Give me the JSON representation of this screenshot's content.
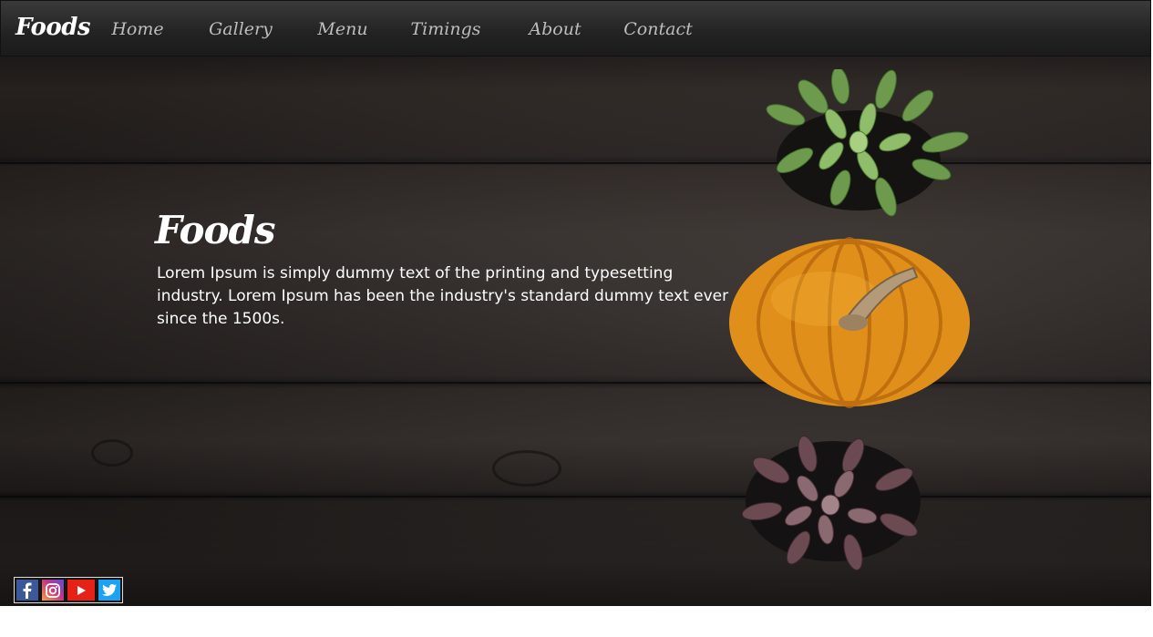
{
  "brand": "Foods",
  "nav": {
    "items": [
      {
        "label": "Home"
      },
      {
        "label": "Gallery"
      },
      {
        "label": "Menu"
      },
      {
        "label": "Timings"
      },
      {
        "label": "About"
      },
      {
        "label": "Contact"
      }
    ]
  },
  "hero": {
    "title": "Foods",
    "text": "Lorem Ipsum is simply dummy text of the printing and typesetting industry. Lorem Ipsum has been the industry's standard dummy text ever since the 1500s."
  },
  "social": [
    {
      "icon": "facebook-icon",
      "color": "#3b5998"
    },
    {
      "icon": "instagram-icon",
      "color": "#c13584"
    },
    {
      "icon": "youtube-icon",
      "color": "#e62117"
    },
    {
      "icon": "twitter-icon",
      "color": "#1da1f2"
    }
  ]
}
